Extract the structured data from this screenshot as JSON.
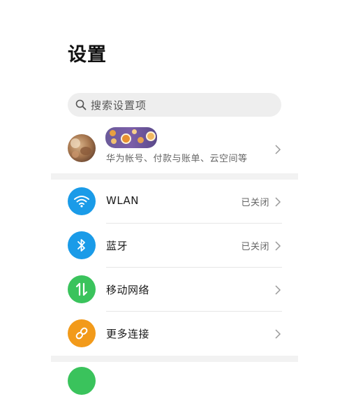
{
  "header": {
    "title": "设置"
  },
  "search": {
    "placeholder": "搜索设置项",
    "icon": "search-icon"
  },
  "account": {
    "subtitle": "华为帐号、付款与账单、云空间等",
    "icon": "avatar"
  },
  "items": [
    {
      "label": "WLAN",
      "status": "已关闭",
      "icon": "wifi-icon",
      "color": "#1a9be8"
    },
    {
      "label": "蓝牙",
      "status": "已关闭",
      "icon": "bluetooth-icon",
      "color": "#1a9be8"
    },
    {
      "label": "移动网络",
      "status": "",
      "icon": "mobile-data-icon",
      "color": "#3ac35c"
    },
    {
      "label": "更多连接",
      "status": "",
      "icon": "link-icon",
      "color": "#f29a1a"
    }
  ],
  "next_item": {
    "icon": "next-setting-icon",
    "color": "#3ac35c"
  }
}
